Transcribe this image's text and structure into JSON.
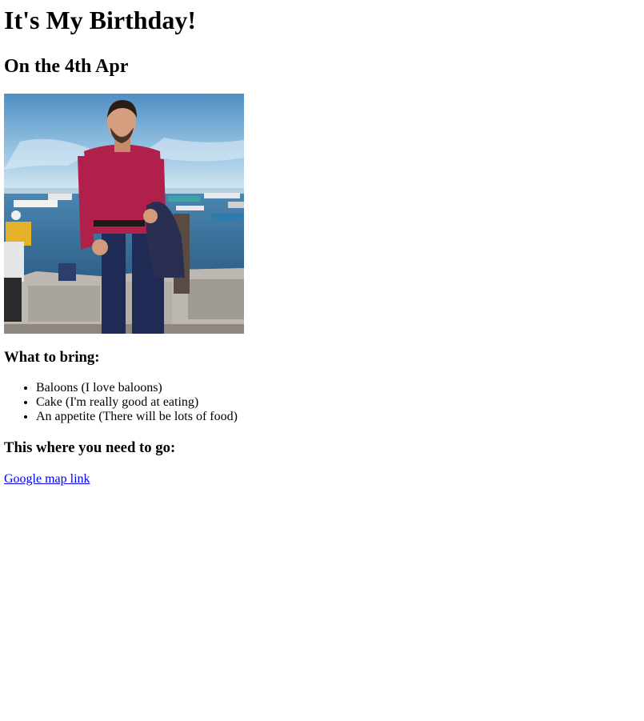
{
  "title": "It's My Birthday!",
  "date_heading": "On the 4th Apr",
  "bring_heading": "What to bring:",
  "bring_items": [
    "Baloons (I love baloons)",
    "Cake (I'm really good at eating)",
    "An appetite (There will be lots of food)"
  ],
  "location_heading": "This where you need to go:",
  "map_link_label": "Google map link",
  "colors": {
    "link": "#0000ee",
    "text": "#000000",
    "background": "#ffffff"
  }
}
